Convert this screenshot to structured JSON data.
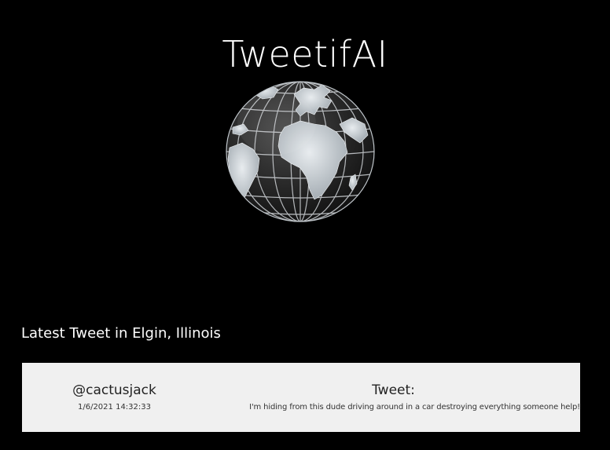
{
  "app": {
    "title": "TweetifAI"
  },
  "globe": {
    "icon": "globe-icon"
  },
  "latest": {
    "heading": "Latest Tweet in Elgin, Illinois"
  },
  "tweet": {
    "username": "@cactusjack",
    "timestamp": "1/6/2021 14:32:33",
    "label": "Tweet:",
    "text": "I'm hiding from this dude driving around in a car destroying everything someone help!"
  },
  "colors": {
    "background": "#000000",
    "card": "#f0f0f0",
    "text_light": "#ffffff",
    "text_dark": "#222222"
  }
}
